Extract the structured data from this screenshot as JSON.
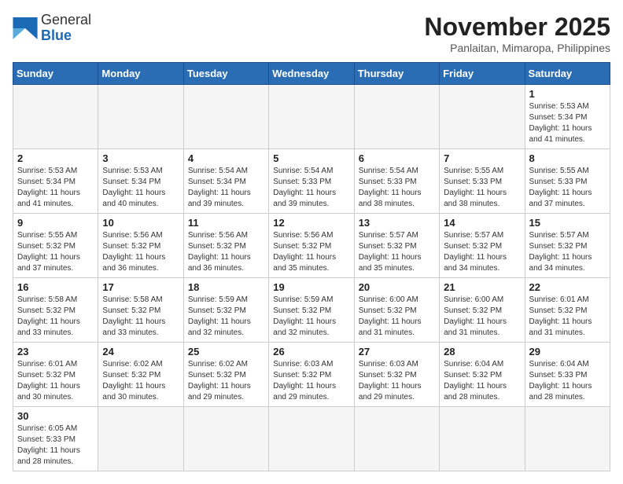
{
  "header": {
    "logo_general": "General",
    "logo_blue": "Blue",
    "month_title": "November 2025",
    "location": "Panlaitan, Mimaropa, Philippines"
  },
  "weekdays": [
    "Sunday",
    "Monday",
    "Tuesday",
    "Wednesday",
    "Thursday",
    "Friday",
    "Saturday"
  ],
  "days": [
    {
      "num": "",
      "info": "",
      "empty": true
    },
    {
      "num": "",
      "info": "",
      "empty": true
    },
    {
      "num": "",
      "info": "",
      "empty": true
    },
    {
      "num": "",
      "info": "",
      "empty": true
    },
    {
      "num": "",
      "info": "",
      "empty": true
    },
    {
      "num": "",
      "info": "",
      "empty": true
    },
    {
      "num": "1",
      "info": "Sunrise: 5:53 AM\nSunset: 5:34 PM\nDaylight: 11 hours\nand 41 minutes."
    },
    {
      "num": "2",
      "info": "Sunrise: 5:53 AM\nSunset: 5:34 PM\nDaylight: 11 hours\nand 41 minutes."
    },
    {
      "num": "3",
      "info": "Sunrise: 5:53 AM\nSunset: 5:34 PM\nDaylight: 11 hours\nand 40 minutes."
    },
    {
      "num": "4",
      "info": "Sunrise: 5:54 AM\nSunset: 5:34 PM\nDaylight: 11 hours\nand 39 minutes."
    },
    {
      "num": "5",
      "info": "Sunrise: 5:54 AM\nSunset: 5:33 PM\nDaylight: 11 hours\nand 39 minutes."
    },
    {
      "num": "6",
      "info": "Sunrise: 5:54 AM\nSunset: 5:33 PM\nDaylight: 11 hours\nand 38 minutes."
    },
    {
      "num": "7",
      "info": "Sunrise: 5:55 AM\nSunset: 5:33 PM\nDaylight: 11 hours\nand 38 minutes."
    },
    {
      "num": "8",
      "info": "Sunrise: 5:55 AM\nSunset: 5:33 PM\nDaylight: 11 hours\nand 37 minutes."
    },
    {
      "num": "9",
      "info": "Sunrise: 5:55 AM\nSunset: 5:32 PM\nDaylight: 11 hours\nand 37 minutes."
    },
    {
      "num": "10",
      "info": "Sunrise: 5:56 AM\nSunset: 5:32 PM\nDaylight: 11 hours\nand 36 minutes."
    },
    {
      "num": "11",
      "info": "Sunrise: 5:56 AM\nSunset: 5:32 PM\nDaylight: 11 hours\nand 36 minutes."
    },
    {
      "num": "12",
      "info": "Sunrise: 5:56 AM\nSunset: 5:32 PM\nDaylight: 11 hours\nand 35 minutes."
    },
    {
      "num": "13",
      "info": "Sunrise: 5:57 AM\nSunset: 5:32 PM\nDaylight: 11 hours\nand 35 minutes."
    },
    {
      "num": "14",
      "info": "Sunrise: 5:57 AM\nSunset: 5:32 PM\nDaylight: 11 hours\nand 34 minutes."
    },
    {
      "num": "15",
      "info": "Sunrise: 5:57 AM\nSunset: 5:32 PM\nDaylight: 11 hours\nand 34 minutes."
    },
    {
      "num": "16",
      "info": "Sunrise: 5:58 AM\nSunset: 5:32 PM\nDaylight: 11 hours\nand 33 minutes."
    },
    {
      "num": "17",
      "info": "Sunrise: 5:58 AM\nSunset: 5:32 PM\nDaylight: 11 hours\nand 33 minutes."
    },
    {
      "num": "18",
      "info": "Sunrise: 5:59 AM\nSunset: 5:32 PM\nDaylight: 11 hours\nand 32 minutes."
    },
    {
      "num": "19",
      "info": "Sunrise: 5:59 AM\nSunset: 5:32 PM\nDaylight: 11 hours\nand 32 minutes."
    },
    {
      "num": "20",
      "info": "Sunrise: 6:00 AM\nSunset: 5:32 PM\nDaylight: 11 hours\nand 31 minutes."
    },
    {
      "num": "21",
      "info": "Sunrise: 6:00 AM\nSunset: 5:32 PM\nDaylight: 11 hours\nand 31 minutes."
    },
    {
      "num": "22",
      "info": "Sunrise: 6:01 AM\nSunset: 5:32 PM\nDaylight: 11 hours\nand 31 minutes."
    },
    {
      "num": "23",
      "info": "Sunrise: 6:01 AM\nSunset: 5:32 PM\nDaylight: 11 hours\nand 30 minutes."
    },
    {
      "num": "24",
      "info": "Sunrise: 6:02 AM\nSunset: 5:32 PM\nDaylight: 11 hours\nand 30 minutes."
    },
    {
      "num": "25",
      "info": "Sunrise: 6:02 AM\nSunset: 5:32 PM\nDaylight: 11 hours\nand 29 minutes."
    },
    {
      "num": "26",
      "info": "Sunrise: 6:03 AM\nSunset: 5:32 PM\nDaylight: 11 hours\nand 29 minutes."
    },
    {
      "num": "27",
      "info": "Sunrise: 6:03 AM\nSunset: 5:32 PM\nDaylight: 11 hours\nand 29 minutes."
    },
    {
      "num": "28",
      "info": "Sunrise: 6:04 AM\nSunset: 5:32 PM\nDaylight: 11 hours\nand 28 minutes."
    },
    {
      "num": "29",
      "info": "Sunrise: 6:04 AM\nSunset: 5:33 PM\nDaylight: 11 hours\nand 28 minutes."
    },
    {
      "num": "30",
      "info": "Sunrise: 6:05 AM\nSunset: 5:33 PM\nDaylight: 11 hours\nand 28 minutes."
    },
    {
      "num": "",
      "info": "",
      "empty": true
    },
    {
      "num": "",
      "info": "",
      "empty": true
    },
    {
      "num": "",
      "info": "",
      "empty": true
    },
    {
      "num": "",
      "info": "",
      "empty": true
    },
    {
      "num": "",
      "info": "",
      "empty": true
    },
    {
      "num": "",
      "info": "",
      "empty": true
    }
  ]
}
